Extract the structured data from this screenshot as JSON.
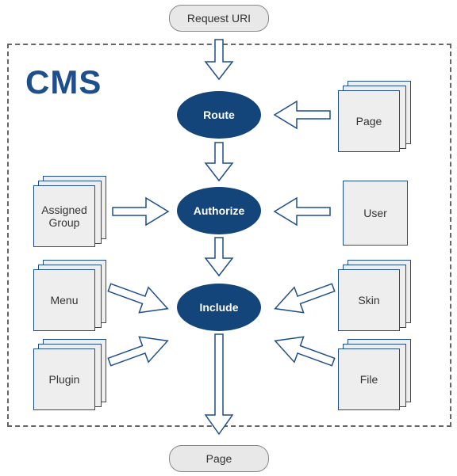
{
  "title": "CMS",
  "request_box": "Request URI",
  "output_box": "Page",
  "steps": {
    "route": "Route",
    "authorize": "Authorize",
    "include": "Include"
  },
  "inputs": {
    "page_stack": "Page",
    "assigned_group": "Assigned Group",
    "user": "User",
    "menu": "Menu",
    "plugin": "Plugin",
    "skin": "Skin",
    "file": "File"
  },
  "colors": {
    "ellipse": "#13457a",
    "border": "#1f4e8c",
    "dashed": "#666666",
    "card_bg": "#eeeeee",
    "title": "#1f4e8c"
  }
}
